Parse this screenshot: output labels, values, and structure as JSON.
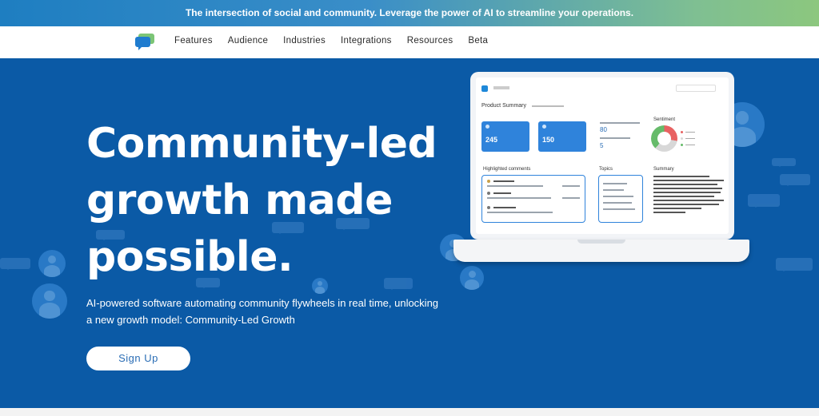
{
  "banner": {
    "text": "The intersection of social and community. Leverage the power of AI to streamline your operations."
  },
  "nav": {
    "logo_icon": "chat-bubbles-logo-icon",
    "links": [
      "Features",
      "Audience",
      "Industries",
      "Integrations",
      "Resources",
      "Beta"
    ]
  },
  "hero": {
    "headline_line1": "Community-led",
    "headline_line2": "growth made",
    "headline_line3": "possible.",
    "subtext": "AI-powered software automating community flywheels in real time, unlocking a new growth model: Community-Led Growth",
    "signup_label": "Sign Up"
  },
  "dashboard": {
    "section_title": "Product Summary",
    "card1_value": "245",
    "card2_value": "150",
    "kpi_value1": "80",
    "kpi_value2": "5",
    "sentiment_label": "Sentiment",
    "highlighted_label": "Highlighted comments",
    "topics_label": "Topics",
    "summary_label": "Summary"
  },
  "colors": {
    "hero_bg": "#0b5aa6",
    "accent": "#2f83db",
    "signup_text": "#2a6db5"
  }
}
